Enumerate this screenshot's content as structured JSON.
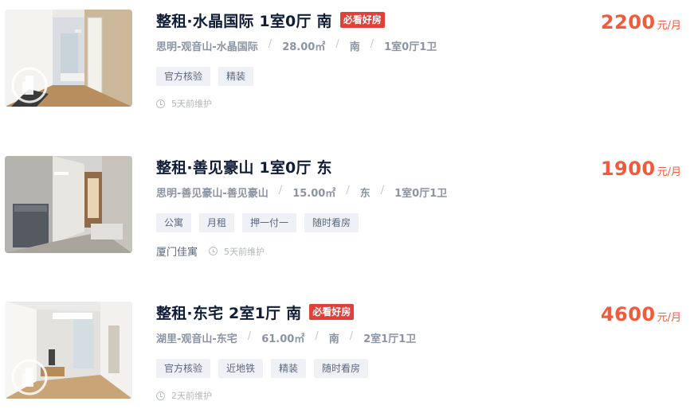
{
  "listings": [
    {
      "title": "整租·水晶国际 1室0厅 南",
      "badge": "必看好房",
      "location": "思明-观音山-水晶国际",
      "area": "28.00㎡",
      "orientation": "南",
      "layout": "1室0厅1卫",
      "tags": [
        "官方核验",
        "精装"
      ],
      "agency": "",
      "maintained": "5天前维护",
      "price": "2200",
      "price_unit": "元/月"
    },
    {
      "title": "整租·善见豪山 1室0厅 东",
      "badge": "",
      "location": "思明-善见豪山-善见豪山",
      "area": "15.00㎡",
      "orientation": "东",
      "layout": "1室0厅1卫",
      "tags": [
        "公寓",
        "月租",
        "押一付一",
        "随时看房"
      ],
      "agency": "厦门佳寓",
      "maintained": "5天前维护",
      "price": "1900",
      "price_unit": "元/月"
    },
    {
      "title": "整租·东宅 2室1厅 南",
      "badge": "必看好房",
      "location": "湖里-观音山-东宅",
      "area": "61.00㎡",
      "orientation": "南",
      "layout": "2室1厅1卫",
      "tags": [
        "官方核验",
        "近地铁",
        "精装",
        "随时看房"
      ],
      "agency": "",
      "maintained": "2天前维护",
      "price": "4600",
      "price_unit": "元/月"
    }
  ],
  "colors": {
    "price": "#f25a3c",
    "badge": "#e0403a",
    "title": "#101d37",
    "tag_bg": "#eef1f5"
  }
}
